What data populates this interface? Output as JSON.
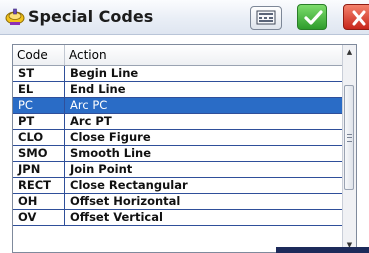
{
  "window": {
    "title": "Special Codes",
    "icons": {
      "app": "survey-app-icon",
      "keyboard": "keyboard-icon",
      "ok": "checkmark-icon",
      "close": "close-icon"
    },
    "colors": {
      "ok": "#2e9c2c",
      "close": "#c7261b",
      "selection": "#2a6cc6"
    }
  },
  "table": {
    "columns": [
      "Code",
      "Action"
    ],
    "rows": [
      {
        "code": "ST",
        "action": "Begin Line"
      },
      {
        "code": "EL",
        "action": "End Line"
      },
      {
        "code": "PC",
        "action": "Arc PC"
      },
      {
        "code": "PT",
        "action": "Arc PT"
      },
      {
        "code": "CLO",
        "action": "Close Figure"
      },
      {
        "code": "SMO",
        "action": "Smooth Line"
      },
      {
        "code": "JPN",
        "action": "Join Point"
      },
      {
        "code": "RECT",
        "action": "Close Rectangular"
      },
      {
        "code": "OH",
        "action": "Offset Horizontal"
      },
      {
        "code": "OV",
        "action": "Offset Vertical"
      }
    ],
    "selected_row": 2
  },
  "scrollbar": {
    "up_glyph": "▲",
    "down_glyph": "▼"
  }
}
